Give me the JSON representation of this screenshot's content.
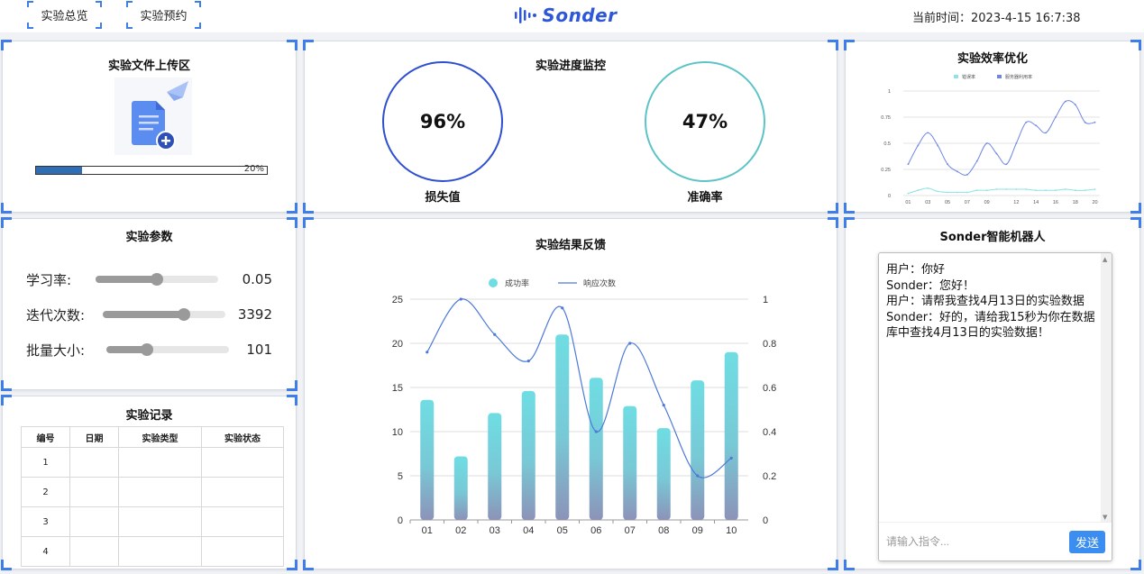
{
  "nav": {
    "overview": "实验总览",
    "booking": "实验预约"
  },
  "logo": {
    "text": "Sonder"
  },
  "header": {
    "time_label": "当前时间：",
    "time_value": "2023-4-15 16:7:38"
  },
  "upload": {
    "title": "实验文件上传区",
    "progress": 0.2,
    "progress_text": "20%"
  },
  "monitor": {
    "title": "实验进度监控",
    "loss": {
      "value": "96%",
      "label": "损失值",
      "color": "#2d4fd0"
    },
    "accuracy": {
      "value": "47%",
      "label": "准确率",
      "color": "#5cc4c6"
    }
  },
  "efficiency": {
    "title": "实验效率优化",
    "legend": [
      "错误率",
      "服务器利用率"
    ]
  },
  "params": {
    "title": "实验参数",
    "items": [
      {
        "label": "学习率:",
        "value": "0.05",
        "level": 0.5
      },
      {
        "label": "迭代次数:",
        "value": "3392",
        "level": 0.66
      },
      {
        "label": "批量大小:",
        "value": "101",
        "level": 0.33
      }
    ]
  },
  "records": {
    "title": "实验记录",
    "columns": [
      "编号",
      "日期",
      "实验类型",
      "实验状态"
    ],
    "rows": [
      [
        "1",
        "",
        "",
        ""
      ],
      [
        "2",
        "",
        "",
        ""
      ],
      [
        "3",
        "",
        "",
        ""
      ],
      [
        "4",
        "",
        "",
        ""
      ]
    ]
  },
  "results": {
    "title": "实验结果反馈"
  },
  "chat": {
    "title": "Sonder智能机器人",
    "messages": [
      "用户：你好",
      "Sonder：您好！",
      "用户：请帮我查找4月13日的实验数据",
      "Sonder：好的，请给我15秒为你在数据库中查找4月13日的实验数据！"
    ],
    "input_placeholder": "请输入指令...",
    "send_label": "发送"
  },
  "chart_data": [
    {
      "type": "line",
      "title": "实验效率优化",
      "x": [
        "01",
        "02",
        "03",
        "04",
        "05",
        "06",
        "07",
        "08",
        "09",
        "10",
        "11",
        "12",
        "13",
        "14",
        "15",
        "16",
        "17",
        "18",
        "19",
        "20"
      ],
      "x_ticks": [
        "01",
        "03",
        "05",
        "07",
        "09",
        "12",
        "14",
        "16",
        "18",
        "20"
      ],
      "ylim": [
        0,
        1
      ],
      "y_ticks": [
        "0",
        "0.25",
        "0.5",
        "0.75",
        "1"
      ],
      "grid": true,
      "legend_position": "top",
      "series": [
        {
          "name": "错误率",
          "color": "#8fe3e8",
          "values": [
            0.02,
            0.05,
            0.07,
            0.04,
            0.03,
            0.03,
            0.03,
            0.05,
            0.05,
            0.06,
            0.06,
            0.06,
            0.06,
            0.05,
            0.05,
            0.05,
            0.06,
            0.05,
            0.05,
            0.06
          ]
        },
        {
          "name": "服务器利用率",
          "color": "#6f86e6",
          "values": [
            0.3,
            0.48,
            0.6,
            0.48,
            0.3,
            0.23,
            0.2,
            0.33,
            0.5,
            0.4,
            0.3,
            0.5,
            0.7,
            0.67,
            0.6,
            0.75,
            0.9,
            0.87,
            0.7,
            0.7
          ]
        }
      ]
    },
    {
      "type": "bar",
      "title": "实验结果反馈",
      "categories": [
        "01",
        "02",
        "03",
        "04",
        "05",
        "06",
        "07",
        "08",
        "09",
        "10"
      ],
      "grid": true,
      "legend_position": "top",
      "series": [
        {
          "name": "成功率",
          "type": "bar",
          "axis": "left",
          "color": "#6fdde3",
          "values": [
            13.6,
            7.2,
            12.1,
            14.6,
            21.0,
            16.1,
            12.9,
            10.4,
            15.8,
            19.0
          ]
        },
        {
          "name": "响应次数",
          "type": "line",
          "axis": "right",
          "color": "#4d79d9",
          "values": [
            0.76,
            1.0,
            0.84,
            0.72,
            0.96,
            0.4,
            0.8,
            0.52,
            0.2,
            0.28
          ]
        }
      ],
      "ylim_left": [
        0,
        25
      ],
      "y_ticks_left": [
        "0",
        "5",
        "10",
        "15",
        "20",
        "25"
      ],
      "ylim_right": [
        0,
        1
      ],
      "y_ticks_right": [
        "0",
        "0.2",
        "0.4",
        "0.6",
        "0.8",
        "1"
      ]
    }
  ]
}
